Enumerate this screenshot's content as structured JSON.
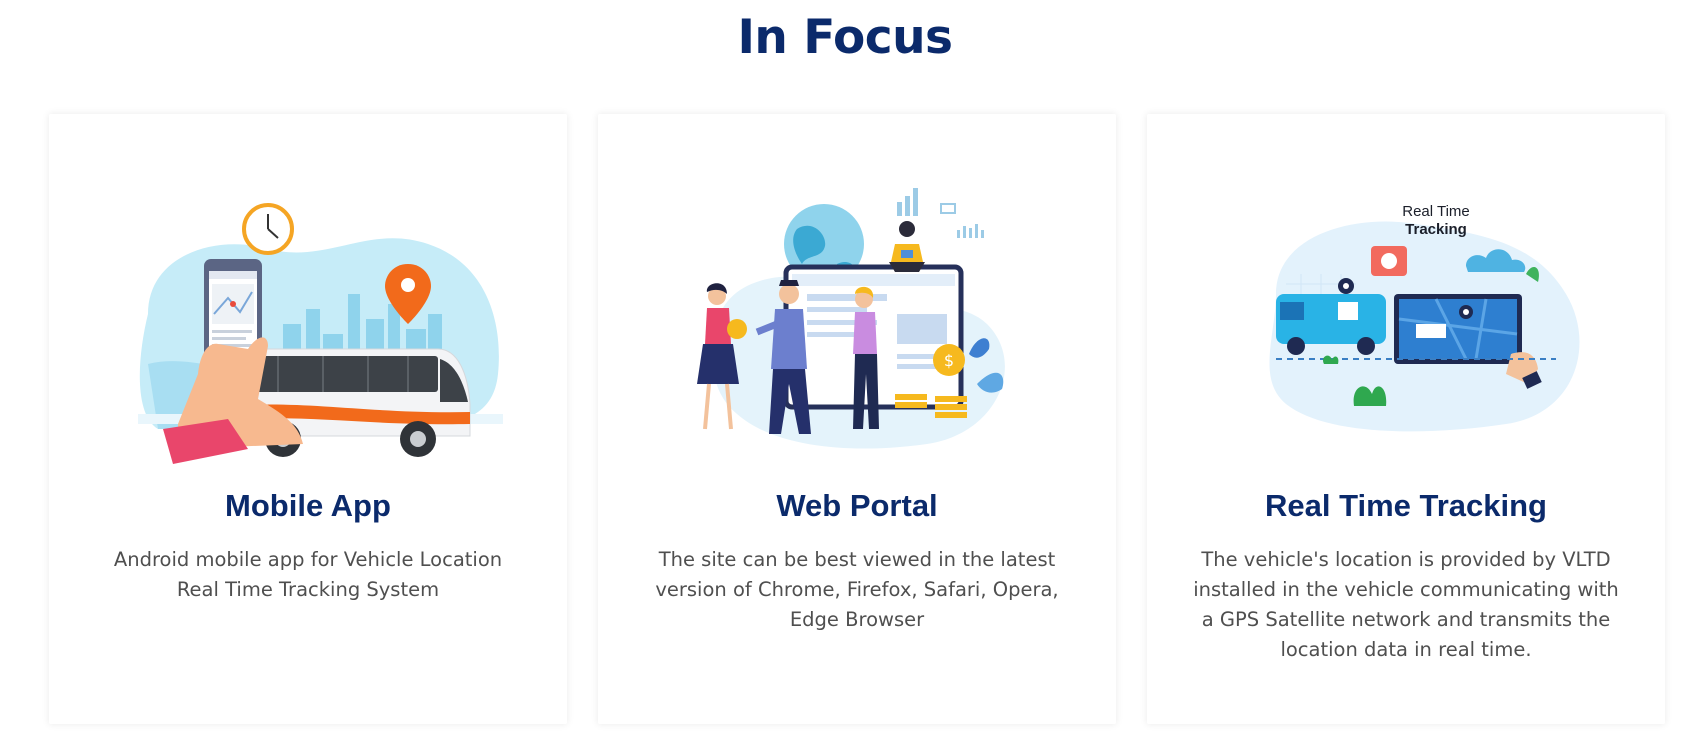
{
  "section": {
    "title": "In Focus"
  },
  "cards": [
    {
      "title": "Mobile App",
      "description": "Android mobile app for Vehicle Location Real Time Tracking System",
      "illustration": "mobile-app-bus-illustration"
    },
    {
      "title": "Web Portal",
      "description": "The site can be best viewed in the latest version of Chrome, Firefox, Safari, Opera, Edge Browser",
      "illustration": "web-portal-team-illustration"
    },
    {
      "title": "Real Time Tracking",
      "description": "The vehicle's location is provided by VLTD installed in the vehicle communicating with a GPS Satellite network and transmits the location data in real time.",
      "illustration": "real-time-tracking-illustration",
      "illustration_text": [
        "Real Time",
        "Tracking"
      ]
    }
  ],
  "colors": {
    "heading": "#0b2a6b",
    "body_text": "#4f4f4f",
    "accent_orange": "#f26a1b",
    "accent_sky": "#bfe8f7"
  }
}
